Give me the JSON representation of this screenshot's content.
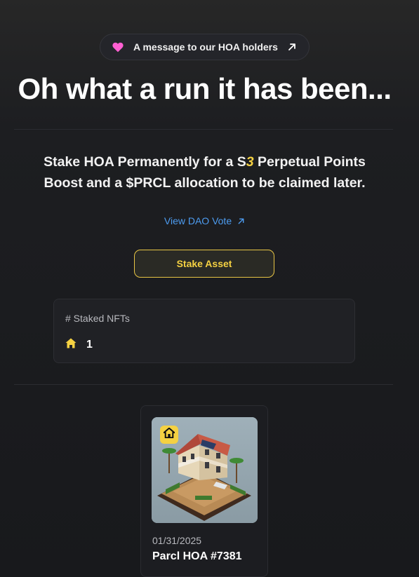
{
  "announcement": {
    "text": "A message to our HOA holders",
    "accent": "#ff5fd2"
  },
  "headline": "Oh what a run it has been...",
  "subtext": {
    "before": "Stake HOA Permanently for a S",
    "season": "3",
    "after": " Perpetual Points Boost and a $PRCL allocation to be claimed later."
  },
  "dao_link": {
    "label": "View DAO Vote",
    "color": "#4d9cf0"
  },
  "stake_button": {
    "label": "Stake Asset",
    "accent": "#f5d142"
  },
  "stats": {
    "label": "# Staked NFTs",
    "count": "1",
    "icon": "home-icon"
  },
  "nfts": [
    {
      "date": "01/31/2025",
      "title": "Parcl HOA #7381",
      "badge_icon": "home-icon"
    }
  ]
}
